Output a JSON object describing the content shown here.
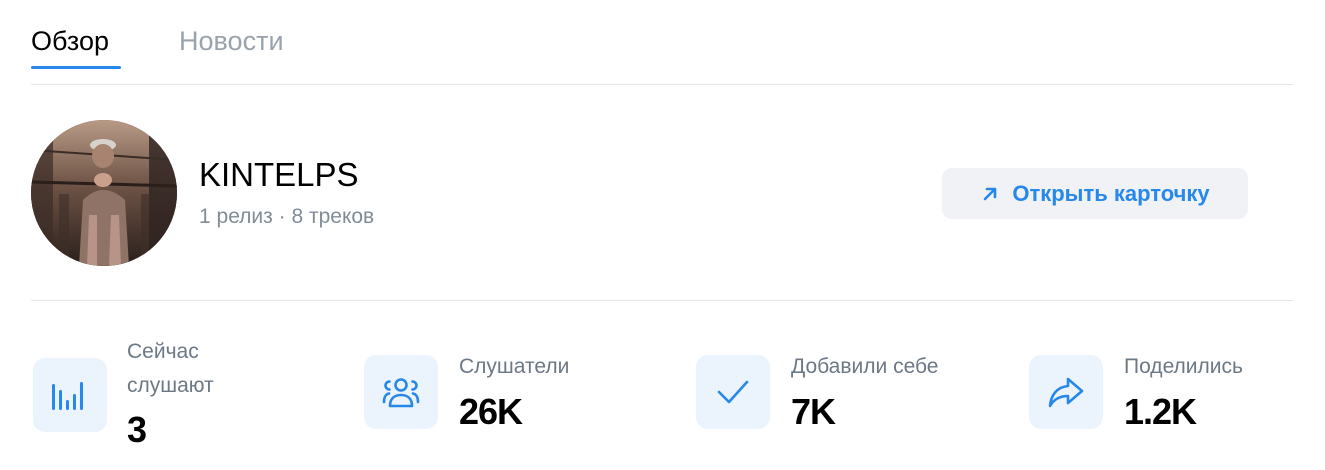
{
  "tabs": [
    {
      "label": "Обзор",
      "active": true
    },
    {
      "label": "Новости",
      "active": false
    }
  ],
  "artist": {
    "name": "KINTELPS",
    "meta": "1 релиз · 8 треков"
  },
  "open_card": {
    "label": "Открыть карточку",
    "icon": "arrow-up-right-icon"
  },
  "stats": [
    {
      "label": "Сейчас слушают",
      "value": "3",
      "icon": "equalizer-bars-icon"
    },
    {
      "label": "Слушатели",
      "value": "26K",
      "icon": "users-icon"
    },
    {
      "label": "Добавили себе",
      "value": "7K",
      "icon": "checkmark-icon"
    },
    {
      "label": "Поделились",
      "value": "1.2K",
      "icon": "share-arrow-icon"
    }
  ],
  "colors": {
    "accent": "#2688eb",
    "icon_bg": "#ebf3fd",
    "secondary_text": "#818c99",
    "button_bg": "#f0f2f5"
  }
}
